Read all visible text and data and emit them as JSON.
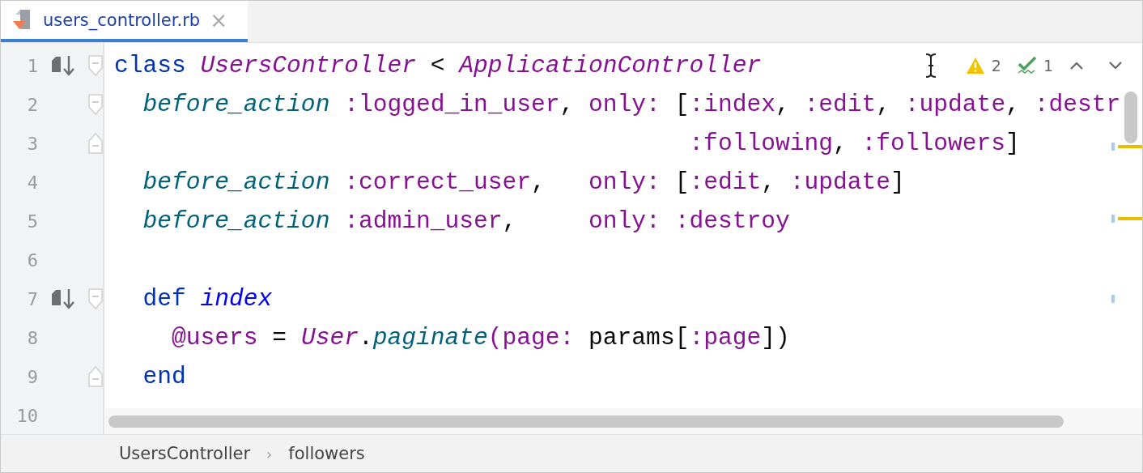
{
  "tab": {
    "label": "users_controller.rb",
    "close": "×",
    "selected": true
  },
  "inspections": {
    "warnings": "2",
    "checks": "1"
  },
  "lines": [
    {
      "number": "1",
      "marker": true,
      "fold_start": true,
      "fold_end": false,
      "tokens": [
        {
          "kind": "kw",
          "text": "class "
        },
        {
          "kind": "cls",
          "text": "UsersController"
        },
        {
          "kind": "plain",
          "text": " < "
        },
        {
          "kind": "cls",
          "text": "ApplicationController"
        }
      ],
      "children": [
        {
          "number": "2",
          "marker": false,
          "fold_start": true,
          "fold_end": false,
          "tokens": [
            {
              "kind": "call",
              "text": "before_action"
            },
            {
              "kind": "sym",
              "text": " :logged_in_user"
            },
            {
              "kind": "plain",
              "text": ", "
            },
            {
              "kind": "sym",
              "text": "only:"
            },
            {
              "kind": "plain",
              "text": " ["
            },
            {
              "kind": "sym",
              "text": ":index"
            },
            {
              "kind": "plain",
              "text": ", "
            },
            {
              "kind": "sym",
              "text": ":edit"
            },
            {
              "kind": "plain",
              "text": ", "
            },
            {
              "kind": "sym",
              "text": ":update"
            },
            {
              "kind": "plain",
              "text": ", "
            },
            {
              "kind": "sym",
              "text": ":destr"
            }
          ]
        },
        {
          "number": "3",
          "kind": "continuation",
          "marker": false,
          "fold_start": false,
          "fold_end": true,
          "tokens": [
            {
              "kind": "sym",
              "text": ":following"
            },
            {
              "kind": "plain",
              "text": ", "
            },
            {
              "kind": "sym",
              "text": ":followers"
            },
            {
              "kind": "plain",
              "text": "]"
            }
          ]
        },
        {
          "number": "4",
          "marker": false,
          "fold_start": false,
          "fold_end": false,
          "tokens": [
            {
              "kind": "call",
              "text": "before_action"
            },
            {
              "kind": "sym",
              "text": " :correct_user"
            },
            {
              "kind": "plain",
              "text": ",   "
            },
            {
              "kind": "sym",
              "text": "only:"
            },
            {
              "kind": "plain",
              "text": " ["
            },
            {
              "kind": "sym",
              "text": ":edit"
            },
            {
              "kind": "plain",
              "text": ", "
            },
            {
              "kind": "sym",
              "text": ":update"
            },
            {
              "kind": "plain",
              "text": "]"
            }
          ]
        },
        {
          "number": "5",
          "marker": false,
          "fold_start": false,
          "fold_end": false,
          "tokens": [
            {
              "kind": "call",
              "text": "before_action"
            },
            {
              "kind": "sym",
              "text": " :admin_user"
            },
            {
              "kind": "plain",
              "text": ",     "
            },
            {
              "kind": "sym",
              "text": "only:"
            },
            {
              "kind": "sym",
              "text": " :destroy"
            }
          ]
        },
        {
          "number": "6",
          "marker": false,
          "fold_start": false,
          "fold_end": false
        },
        {
          "number": "7",
          "marker": true,
          "fold_start": true,
          "fold_end": false,
          "tokens": [
            {
              "kind": "kw",
              "text": "def "
            },
            {
              "kind": "fn",
              "text": "index"
            }
          ],
          "children": [
            {
              "number": "8",
              "marker": false,
              "fold_start": false,
              "fold_end": false,
              "tokens": [
                {
                  "kind": "sym",
                  "text": "@users"
                },
                {
                  "kind": "plain",
                  "text": " = "
                },
                {
                  "kind": "cls",
                  "text": "User"
                },
                {
                  "kind": "plain",
                  "text": "."
                },
                {
                  "kind": "call",
                  "text": "paginate"
                },
                {
                  "kind": "sym",
                  "text": "(page:"
                },
                {
                  "kind": "plain",
                  "text": " params["
                },
                {
                  "kind": "sym",
                  "text": ":page"
                },
                {
                  "kind": "plain",
                  "text": "])"
                }
              ]
            }
          ]
        },
        {
          "number": "9",
          "marker": false,
          "fold_start": false,
          "fold_end": true,
          "tokens": [
            {
              "kind": "kw",
              "text": "end"
            }
          ]
        }
      ]
    },
    {
      "number": "10",
      "marker": false,
      "fold_start": false,
      "fold_end": false
    }
  ],
  "breadcrumbs": [
    "UsersController",
    "followers"
  ],
  "breadcrumb_separator": "›"
}
